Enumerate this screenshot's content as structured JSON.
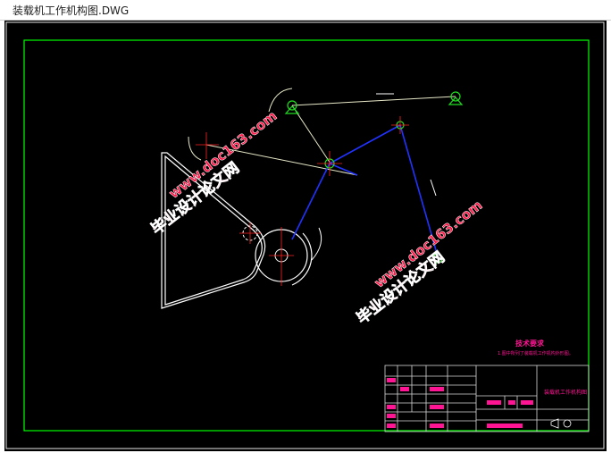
{
  "window": {
    "title": "装载机工作机构图.DWG"
  },
  "watermarks": [
    {
      "cn": "毕业设计论文网",
      "url": "www.doc163.com"
    },
    {
      "cn": "毕业设计论文网",
      "url": "www.doc163.com"
    }
  ],
  "tech_requirements": {
    "heading": "技术要求",
    "line": "1.图中所列了装载机工作机构外形图。"
  },
  "title_block": {
    "drawing_name": "装载机工作机构图"
  },
  "colors": {
    "background": "#000000",
    "border": "#00ff00",
    "mechanism": "#ffffff",
    "links": "#1a1aff",
    "center_marks": "#ff0000",
    "watermark": "#ff1a4a",
    "text_annotation": "#ff1493"
  }
}
